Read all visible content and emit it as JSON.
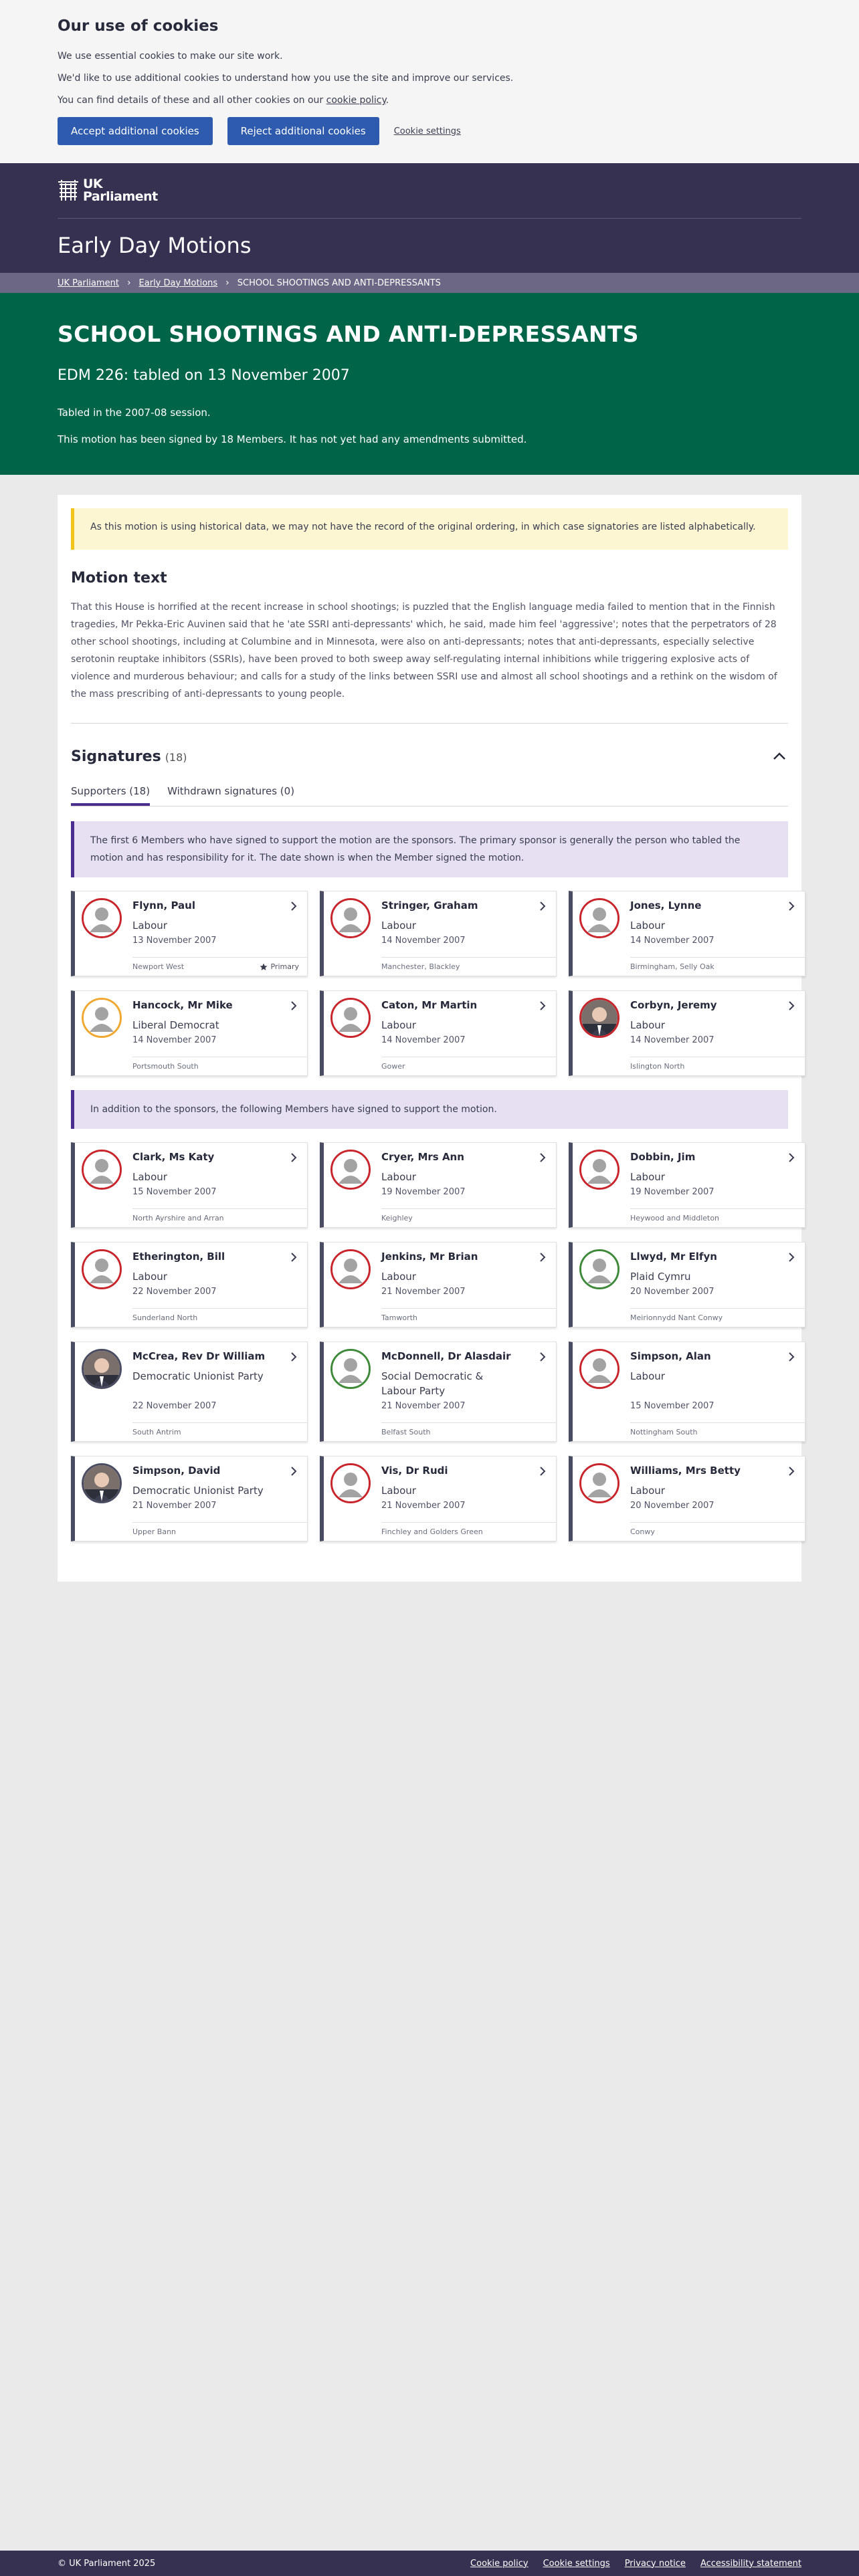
{
  "cookie": {
    "title": "Our use of cookies",
    "line1": "We use essential cookies to make our site work.",
    "line2": "We'd like to use additional cookies to understand how you use the site and improve our services.",
    "line3_prefix": "You can find details of these and all other cookies on our ",
    "line3_link": "cookie policy",
    "line3_suffix": ".",
    "accept": "Accept additional cookies",
    "reject": "Reject additional cookies",
    "settings": "Cookie settings"
  },
  "header": {
    "logo_line1": "UK",
    "logo_line2": "Parliament",
    "section_title": "Early Day Motions"
  },
  "breadcrumb": {
    "items": [
      "UK Parliament",
      "Early Day Motions"
    ],
    "current": "SCHOOL SHOOTINGS AND ANTI-DEPRESSANTS"
  },
  "hero": {
    "title": "SCHOOL SHOOTINGS AND ANTI-DEPRESSANTS",
    "subtitle": "EDM 226: tabled on 13 November 2007",
    "session": "Tabled in the 2007-08 session.",
    "signed": "This motion has been signed by 18 Members. It has not yet had any amendments submitted."
  },
  "notice": "As this motion is using historical data, we may not have the record of the original ordering, in which case signatories are listed alphabetically.",
  "motion": {
    "heading": "Motion text",
    "text": "That this House is horrified at the recent increase in school shootings; is puzzled that the English language media failed to mention that in the Finnish tragedies, Mr Pekka-Eric Auvinen said that he 'ate SSRI anti-depressants' which, he said, made him feel 'aggressive'; notes that the perpetrators of 28 other school shootings, including at Columbine and in Minnesota, were also on anti-depressants; notes that anti-depressants, especially selective serotonin reuptake inhibitors (SSRIs), have been proved to both sweep away self-regulating internal inhibitions while triggering explosive acts of violence and murderous behaviour; and calls for a study of the links between SSRI use and almost all school shootings and a rethink on the wisdom of the mass prescribing of anti-depressants to young people."
  },
  "signatures": {
    "heading": "Signatures",
    "count": "(18)",
    "tabs": [
      "Supporters (18)",
      "Withdrawn signatures (0)"
    ],
    "sponsors_notice": "The first 6 Members who have signed to support the motion are the sponsors. The primary sponsor is generally the person who tabled the motion and has responsibility for it. The date shown is when the Member signed the motion.",
    "supporters_notice": "In addition to the sponsors, the following Members have signed to support the motion.",
    "primary_label": "Primary",
    "sponsors": [
      {
        "name": "Flynn, Paul",
        "party": "Labour",
        "date": "13 November 2007",
        "constituency": "Newport West",
        "photo": false,
        "ring": "#c8252c",
        "primary": true
      },
      {
        "name": "Stringer, Graham",
        "party": "Labour",
        "date": "14 November 2007",
        "constituency": "Manchester, Blackley",
        "photo": false,
        "ring": "#c8252c"
      },
      {
        "name": "Jones, Lynne",
        "party": "Labour",
        "date": "14 November 2007",
        "constituency": "Birmingham, Selly Oak",
        "photo": false,
        "ring": "#c8252c"
      },
      {
        "name": "Hancock, Mr Mike",
        "party": "Liberal Democrat",
        "date": "14 November 2007",
        "constituency": "Portsmouth South",
        "photo": false,
        "ring": "#f0a830"
      },
      {
        "name": "Caton, Mr Martin",
        "party": "Labour",
        "date": "14 November 2007",
        "constituency": "Gower",
        "photo": false,
        "ring": "#c8252c"
      },
      {
        "name": "Corbyn, Jeremy",
        "party": "Labour",
        "date": "14 November 2007",
        "constituency": "Islington North",
        "photo": true,
        "ring": "#c8252c"
      }
    ],
    "supporters": [
      {
        "name": "Clark, Ms Katy",
        "party": "Labour",
        "date": "15 November 2007",
        "constituency": "North Ayrshire and Arran",
        "photo": false,
        "ring": "#c8252c"
      },
      {
        "name": "Cryer, Mrs Ann",
        "party": "Labour",
        "date": "19 November 2007",
        "constituency": "Keighley",
        "photo": false,
        "ring": "#c8252c"
      },
      {
        "name": "Dobbin, Jim",
        "party": "Labour",
        "date": "19 November 2007",
        "constituency": "Heywood and Middleton",
        "photo": false,
        "ring": "#c8252c"
      },
      {
        "name": "Etherington, Bill",
        "party": "Labour",
        "date": "22 November 2007",
        "constituency": "Sunderland North",
        "photo": false,
        "ring": "#c8252c"
      },
      {
        "name": "Jenkins, Mr Brian",
        "party": "Labour",
        "date": "21 November 2007",
        "constituency": "Tamworth",
        "photo": false,
        "ring": "#c8252c"
      },
      {
        "name": "Llwyd, Mr Elfyn",
        "party": "Plaid Cymru",
        "date": "20 November 2007",
        "constituency": "Meirionnydd Nant Conwy",
        "photo": false,
        "ring": "#3f8a3a"
      },
      {
        "name": "McCrea, Rev Dr William",
        "party": "Democratic Unionist Party",
        "date": "22 November 2007",
        "constituency": "South Antrim",
        "photo": true,
        "ring": "#4a4d62"
      },
      {
        "name": "McDonnell, Dr Alasdair",
        "party": "Social Democratic & Labour Party",
        "date": "21 November 2007",
        "constituency": "Belfast South",
        "photo": false,
        "ring": "#3f8a3a"
      },
      {
        "name": "Simpson, Alan",
        "party": "Labour",
        "date": "15 November 2007",
        "constituency": "Nottingham South",
        "photo": false,
        "ring": "#c8252c"
      },
      {
        "name": "Simpson, David",
        "party": "Democratic Unionist Party",
        "date": "21 November 2007",
        "constituency": "Upper Bann",
        "photo": true,
        "ring": "#4a4d62"
      },
      {
        "name": "Vis, Dr Rudi",
        "party": "Labour",
        "date": "21 November 2007",
        "constituency": "Finchley and Golders Green",
        "photo": false,
        "ring": "#c8252c"
      },
      {
        "name": "Williams, Mrs Betty",
        "party": "Labour",
        "date": "20 November 2007",
        "constituency": "Conwy",
        "photo": false,
        "ring": "#c8252c"
      }
    ]
  },
  "footer": {
    "copyright": "© UK Parliament 2025",
    "links": [
      "Cookie policy",
      "Cookie settings",
      "Privacy notice",
      "Accessibility statement"
    ]
  }
}
